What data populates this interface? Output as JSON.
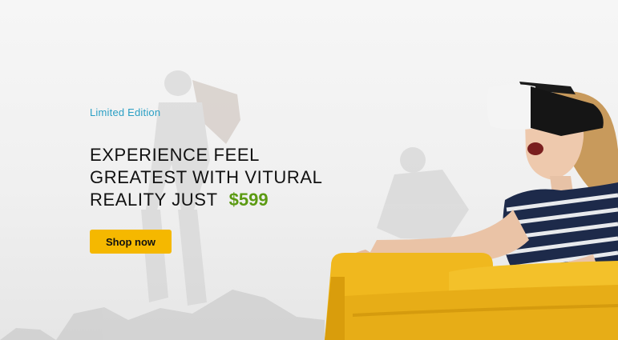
{
  "hero": {
    "eyebrow": "Limited Edition",
    "headline_line1": "EXPERIENCE FEEL",
    "headline_line2": "GREATEST WITH VITURAL",
    "headline_line3": "REALITY JUST",
    "price": "$599",
    "cta_label": "Shop now"
  },
  "colors": {
    "eyebrow": "#2a9fc4",
    "price": "#5b9a12",
    "cta": "#f5b800",
    "sofa": "#f0b81e"
  }
}
